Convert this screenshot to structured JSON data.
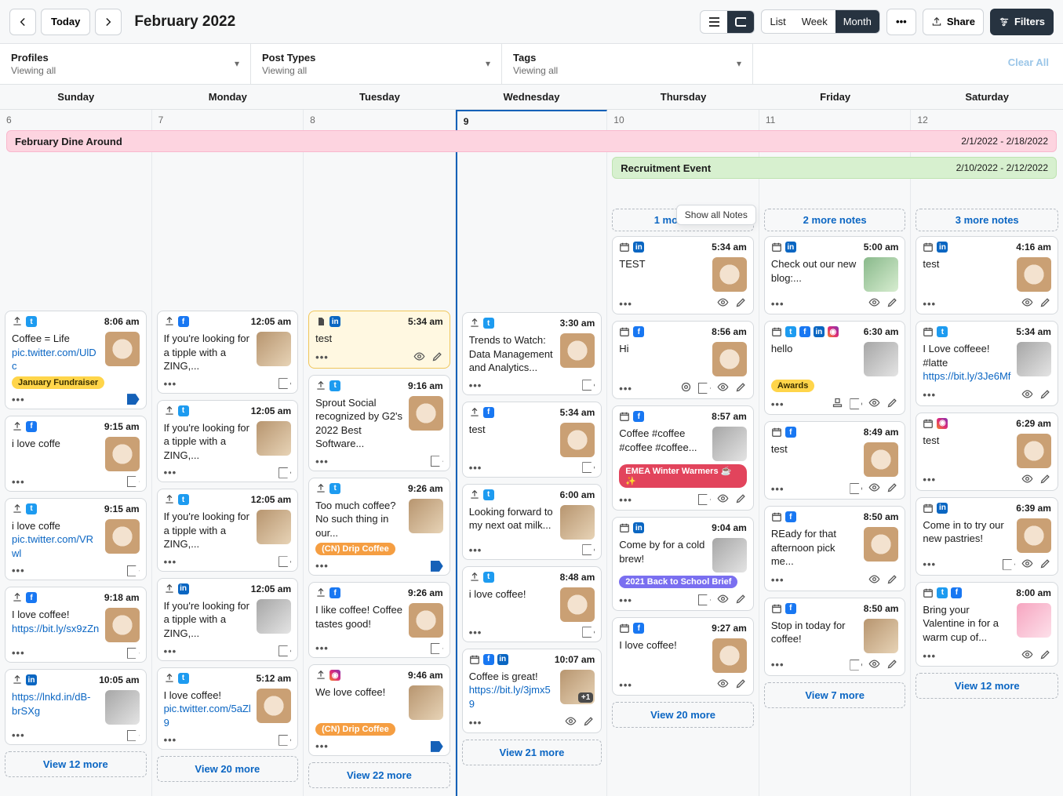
{
  "header": {
    "today": "Today",
    "title": "February 2022",
    "views": {
      "list": "List",
      "week": "Week",
      "month": "Month"
    },
    "share": "Share",
    "filters": "Filters"
  },
  "filters": {
    "profiles": {
      "label": "Profiles",
      "sub": "Viewing all"
    },
    "postTypes": {
      "label": "Post Types",
      "sub": "Viewing all"
    },
    "tags": {
      "label": "Tags",
      "sub": "Viewing all"
    },
    "clear": "Clear All"
  },
  "weekdays": [
    "Sunday",
    "Monday",
    "Tuesday",
    "Wednesday",
    "Thursday",
    "Friday",
    "Saturday"
  ],
  "dayNums": [
    "6",
    "7",
    "8",
    "9",
    "10",
    "11",
    "12"
  ],
  "banners": {
    "dine": {
      "title": "February Dine Around",
      "dates": "2/1/2022 - 2/18/2022"
    },
    "recruit": {
      "title": "Recruitment Event",
      "dates": "2/10/2022 - 2/12/2022"
    }
  },
  "notes": {
    "thu": "1 more note",
    "fri": "2 more notes",
    "sat": "3 more notes",
    "tooltip": "Show all Notes"
  },
  "viewMore": {
    "sun": "View 12 more",
    "mon": "View 20 more",
    "tue": "View 22 more",
    "wed": "View 21 more",
    "thu": "View 20 more",
    "fri": "View 7 more",
    "sat": "View 12 more"
  },
  "cards": {
    "sun": [
      {
        "time": "8:06 am",
        "net": [
          "up",
          "tw"
        ],
        "text": "Coffee = Life",
        "link": "pic.twitter.com/UlDc",
        "pill": {
          "cls": "yellow",
          "t": "January Fundraiser"
        },
        "foot": [
          "tagblue"
        ]
      },
      {
        "time": "9:15 am",
        "net": [
          "up",
          "fb"
        ],
        "text": "i love coffe",
        "foot": [
          "tagout"
        ]
      },
      {
        "time": "9:15 am",
        "net": [
          "up",
          "tw"
        ],
        "text": "i love coffe",
        "link": "pic.twitter.com/VRwl",
        "foot": [
          "tagout"
        ]
      },
      {
        "time": "9:18 am",
        "net": [
          "up",
          "fb"
        ],
        "text": "I love coffee!",
        "link": "https://bit.ly/sx9zZn",
        "foot": [
          "tagout"
        ]
      },
      {
        "time": "10:05 am",
        "net": [
          "up",
          "li"
        ],
        "link": "https://lnkd.in/dB-brSXg",
        "thumb": "alt3",
        "foot": [
          "tagout"
        ]
      }
    ],
    "mon": [
      {
        "time": "12:05 am",
        "net": [
          "up",
          "fb"
        ],
        "text": "If you're looking for a tipple with a ZING,...",
        "thumb": "alt1",
        "foot": [
          "tagout"
        ]
      },
      {
        "time": "12:05 am",
        "net": [
          "up",
          "tw"
        ],
        "text": "If you're looking for a tipple with a ZING,...",
        "thumb": "alt1",
        "foot": [
          "tagout"
        ]
      },
      {
        "time": "12:05 am",
        "net": [
          "up",
          "tw"
        ],
        "text": "If you're looking for a tipple with a ZING,...",
        "thumb": "alt1",
        "foot": [
          "tagout"
        ]
      },
      {
        "time": "12:05 am",
        "net": [
          "up",
          "li"
        ],
        "text": "If you're looking for a tipple with a ZING,...",
        "thumb": "alt3",
        "foot": [
          "tagout"
        ]
      },
      {
        "time": "5:12 am",
        "net": [
          "up",
          "tw"
        ],
        "text": "I love coffee!",
        "link": "pic.twitter.com/5aZl9",
        "foot": [
          "tagout"
        ]
      }
    ],
    "tue": [
      {
        "time": "5:34 am",
        "net": [
          "doc",
          "li"
        ],
        "text": "test",
        "hl": true,
        "foot": [
          "eye",
          "pen"
        ]
      },
      {
        "time": "9:16 am",
        "net": [
          "up",
          "tw"
        ],
        "text": "Sprout Social recognized by G2's 2022 Best Software...",
        "foot": [
          "tagout"
        ]
      },
      {
        "time": "9:26 am",
        "net": [
          "up",
          "tw"
        ],
        "text": "Too much coffee? No such thing in our...",
        "thumb": "alt1",
        "pill": {
          "cls": "orange",
          "t": "(CN) Drip Coffee"
        },
        "foot": [
          "tagblue"
        ]
      },
      {
        "time": "9:26 am",
        "net": [
          "up",
          "fb"
        ],
        "text": "I like coffee! Coffee tastes good!",
        "foot": [
          "tagout"
        ]
      },
      {
        "time": "9:46 am",
        "net": [
          "up",
          "ig"
        ],
        "text": "We love coffee!",
        "thumb": "alt1",
        "pill": {
          "cls": "orange",
          "t": "(CN) Drip Coffee"
        },
        "foot": [
          "tagblue"
        ]
      }
    ],
    "wed": [
      {
        "time": "3:30 am",
        "net": [
          "up",
          "tw"
        ],
        "text": "Trends to Watch: Data Management and Analytics...",
        "foot": [
          "tagout"
        ]
      },
      {
        "time": "5:34 am",
        "net": [
          "up",
          "fb"
        ],
        "text": "test",
        "foot": [
          "tagout"
        ]
      },
      {
        "time": "6:00 am",
        "net": [
          "up",
          "tw"
        ],
        "text": "Looking forward to my next oat milk...",
        "thumb": "alt1",
        "foot": [
          "tagout"
        ]
      },
      {
        "time": "8:48 am",
        "net": [
          "up",
          "tw"
        ],
        "text": "i love coffee!",
        "foot": [
          "tagout"
        ]
      },
      {
        "time": "10:07 am",
        "net": [
          "cal",
          "fb",
          "li"
        ],
        "text": "Coffee is great!",
        "link": "https://bit.ly/3jmx59",
        "thumb": "alt1",
        "plus": "+1",
        "foot": [
          "eye",
          "pen"
        ]
      }
    ],
    "thu": [
      {
        "time": "5:34 am",
        "net": [
          "cal",
          "li"
        ],
        "text": "TEST",
        "thumb": "",
        "foot": [
          "eye",
          "pen"
        ]
      },
      {
        "time": "8:56 am",
        "net": [
          "cal",
          "fb"
        ],
        "text": "Hi",
        "foot": [
          "target",
          "tagout",
          "eye",
          "pen"
        ]
      },
      {
        "time": "8:57 am",
        "net": [
          "cal",
          "fb"
        ],
        "text": "Coffee #coffee #coffee #coffee...",
        "thumb": "alt3",
        "pill": {
          "cls": "red",
          "t": "EMEA Winter Warmers ☕✨"
        },
        "foot": [
          "tagout",
          "eye",
          "pen"
        ]
      },
      {
        "time": "9:04 am",
        "net": [
          "cal",
          "li"
        ],
        "text": "Come by for a cold brew!",
        "thumb": "alt3",
        "pill": {
          "cls": "purple",
          "t": "2021 Back to School Brief"
        },
        "foot": [
          "tagout",
          "eye",
          "pen"
        ]
      },
      {
        "time": "9:27 am",
        "net": [
          "cal",
          "fb"
        ],
        "text": "I love coffee!",
        "foot": [
          "eye",
          "pen"
        ]
      }
    ],
    "fri": [
      {
        "time": "5:00 am",
        "net": [
          "cal",
          "li"
        ],
        "text": "Check out our new blog:...",
        "thumb": "alt2",
        "foot": [
          "eye",
          "pen"
        ]
      },
      {
        "time": "6:30 am",
        "net": [
          "cal",
          "tw",
          "fb",
          "li",
          "ig"
        ],
        "text": "hello",
        "thumb": "alt3",
        "pill": {
          "cls": "yellow",
          "t": "Awards"
        },
        "foot": [
          "stamp",
          "tagout",
          "eye",
          "pen"
        ]
      },
      {
        "time": "8:49 am",
        "net": [
          "cal",
          "fb"
        ],
        "text": "test",
        "thumb": "",
        "foot": [
          "tagout",
          "eye",
          "pen"
        ]
      },
      {
        "time": "8:50 am",
        "net": [
          "cal",
          "fb"
        ],
        "text": "REady for that afternoon pick me...",
        "thumb": "",
        "foot": [
          "eye",
          "pen"
        ]
      },
      {
        "time": "8:50 am",
        "net": [
          "cal",
          "fb"
        ],
        "text": "Stop in today for coffee!",
        "thumb": "alt1",
        "foot": [
          "tagout",
          "eye",
          "pen"
        ]
      }
    ],
    "sat": [
      {
        "time": "4:16 am",
        "net": [
          "cal",
          "li"
        ],
        "text": "test",
        "thumb": "",
        "foot": [
          "eye",
          "pen"
        ]
      },
      {
        "time": "5:34 am",
        "net": [
          "cal",
          "tw"
        ],
        "text": "I Love coffeee! #latte",
        "link": "https://bit.ly/3Je6Mf",
        "thumb": "alt3",
        "foot": [
          "eye",
          "pen"
        ]
      },
      {
        "time": "6:29 am",
        "net": [
          "cal",
          "ig"
        ],
        "text": "test",
        "thumb": "",
        "foot": [
          "eye",
          "pen"
        ]
      },
      {
        "time": "6:39 am",
        "net": [
          "cal",
          "li"
        ],
        "text": "Come in to try our new pastries!",
        "thumb": "",
        "foot": [
          "tagout",
          "eye",
          "pen"
        ]
      },
      {
        "time": "8:00 am",
        "net": [
          "cal",
          "tw",
          "fb"
        ],
        "text": "Bring your Valentine in for a warm cup of...",
        "thumb": "alt4",
        "foot": [
          "eye",
          "pen"
        ]
      }
    ]
  }
}
